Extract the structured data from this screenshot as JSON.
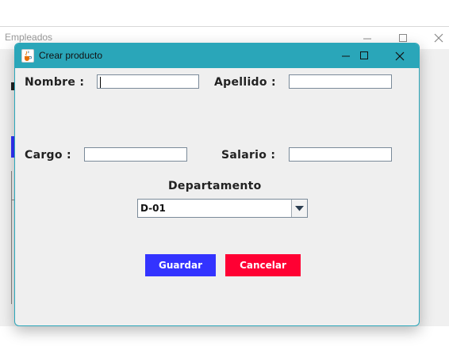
{
  "background_window": {
    "title": "Empleados",
    "controls": [
      "minimize",
      "maximize",
      "close"
    ]
  },
  "dialog": {
    "title": "Crear producto",
    "title_icon": "java-cup-icon",
    "controls": [
      "minimize",
      "maximize",
      "close"
    ],
    "colors": {
      "titlebar": "#2aa6b9",
      "save_button": "#3333ff",
      "cancel_button": "#ff0033",
      "body": "#efefef"
    }
  },
  "form": {
    "nombre_label": "Nombre :",
    "nombre_value": "",
    "apellido_label": "Apellido :",
    "apellido_value": "",
    "cargo_label": "Cargo :",
    "cargo_value": "",
    "salario_label": "Salario :",
    "salario_value": "",
    "departamento_label": "Departamento",
    "departamento_selected": "D-01"
  },
  "buttons": {
    "save_label": "Guardar",
    "cancel_label": "Cancelar"
  }
}
